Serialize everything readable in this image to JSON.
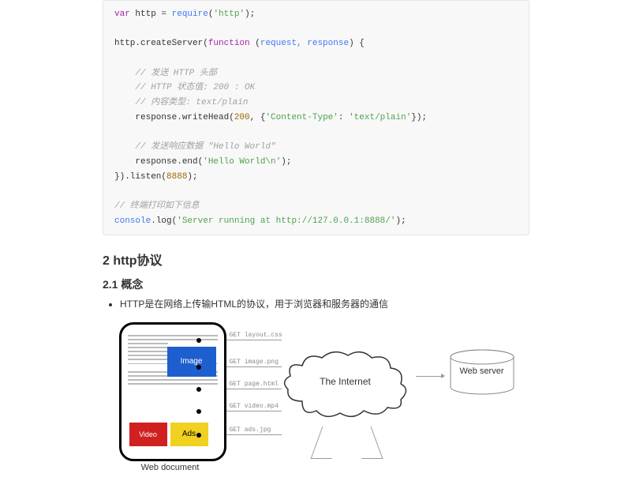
{
  "code": {
    "l1a": "var",
    "l1b": " http = ",
    "l1c": "require",
    "l1d": "(",
    "l1e": "'http'",
    "l1f": ");",
    "l2a": "http.createServer(",
    "l2b": "function",
    "l2c": " (",
    "l2d": "request, response",
    "l2e": ") {",
    "c1": "    // 发送 HTTP 头部",
    "c2": "    // HTTP 状态值: 200 : OK",
    "c3": "    // 内容类型: text/plain",
    "l3a": "    response.writeHead(",
    "l3b": "200",
    "l3c": ", {",
    "l3d": "'Content-Type'",
    "l3e": ": ",
    "l3f": "'text/plain'",
    "l3g": "});",
    "c4": "    // 发送响应数据 \"Hello World\"",
    "l4a": "    response.end(",
    "l4b": "'Hello World\\n'",
    "l4c": ");",
    "l5a": "}).listen(",
    "l5b": "8888",
    "l5c": ");",
    "c5": "// 终端打印如下信息",
    "l6a": "console",
    "l6b": ".log(",
    "l6c": "'Server running at http://127.0.0.1:8888/'",
    "l6d": ");"
  },
  "headings": {
    "h2": "2 http协议",
    "h3": "2.1 概念"
  },
  "bullet": "HTTP是在网络上传输HTML的协议，用于浏览器和服务器的通信",
  "diagram": {
    "image": "Image",
    "video": "Video",
    "ads": "Ads",
    "webdoc": "Web document",
    "internet": "The Internet",
    "webserver": "Web server",
    "r1": "GET layout.css",
    "r2": "GET image.png",
    "r3": "GET page.html",
    "r4": "GET video.mp4",
    "r5": "GET ads.jpg"
  }
}
